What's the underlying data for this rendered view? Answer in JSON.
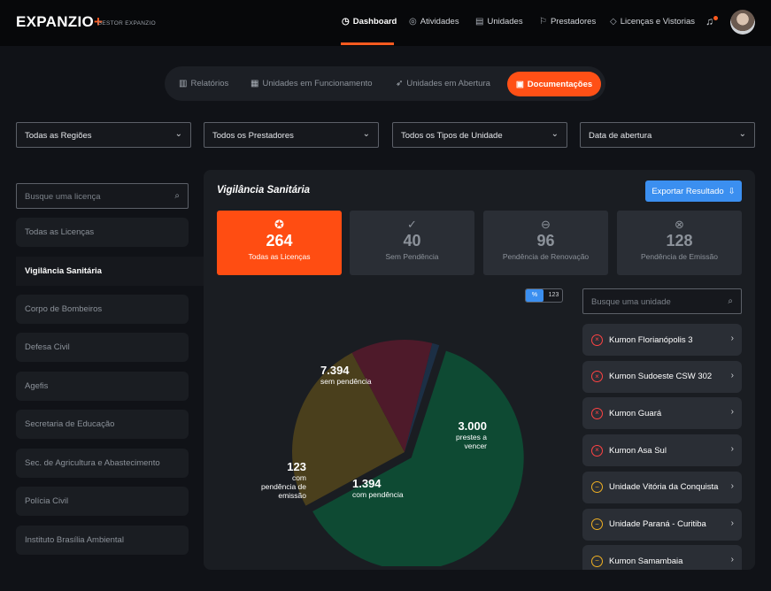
{
  "header": {
    "logo": "EXPANZIO",
    "logo_plus": "+",
    "logo_sub": "GESTOR EXPANZIO",
    "nav": [
      {
        "label": "Dashboard",
        "icon": "gauge-icon"
      },
      {
        "label": "Atividades",
        "icon": "check-circle-icon"
      },
      {
        "label": "Unidades",
        "icon": "building-icon"
      },
      {
        "label": "Prestadores",
        "icon": "flag-icon"
      },
      {
        "label": "Licenças e Vistorias",
        "icon": "tag-icon"
      }
    ]
  },
  "segments": {
    "items": [
      "Relatórios",
      "Unidades em Funcionamento",
      "Unidades em Abertura"
    ],
    "active": "Documentações"
  },
  "filters": [
    "Todas as Regiões",
    "Todos os Prestadores",
    "Todos os Tipos de Unidade",
    "Data de abertura"
  ],
  "sidebar": {
    "search_placeholder": "Busque uma licença",
    "items": [
      "Todas as Licenças",
      "Vigilância Sanitária",
      "Corpo de Bombeiros",
      "Defesa Civil",
      "Agefis",
      "Secretaria de Educação",
      "Sec. de Agricultura e Abastecimento",
      "Polícia Civil",
      "Instituto Brasília Ambiental"
    ],
    "active_index": 1
  },
  "panel": {
    "title": "Vigilância Sanitária",
    "export_label": "Exportar Resultado"
  },
  "cards": [
    {
      "value": "264",
      "label": "Todas as Licenças",
      "icon": "award-icon"
    },
    {
      "value": "40",
      "label": "Sem Pendência",
      "icon": "check-circle-icon"
    },
    {
      "value": "96",
      "label": "Pendência de Renovação",
      "icon": "minus-circle-icon"
    },
    {
      "value": "128",
      "label": "Pendência de Emissão",
      "icon": "x-circle-icon"
    }
  ],
  "toggle": {
    "percent": "%",
    "number": "123"
  },
  "chart_data": {
    "type": "pie",
    "slices": [
      {
        "value": 7394,
        "display": "7.394",
        "label": "sem pendência",
        "color": "#0e4a33"
      },
      {
        "value": 3000,
        "display": "3.000",
        "label": "prestes a vencer",
        "color": "#4a3f1c"
      },
      {
        "value": 1394,
        "display": "1.394",
        "label": "com pendência",
        "color": "#4e1a2a"
      },
      {
        "value": 123,
        "display": "123",
        "label": "com pendência de emissão",
        "color": "#1c2f45"
      }
    ]
  },
  "unit_search_placeholder": "Busque uma unidade",
  "units": [
    {
      "name": "Kumon Florianópolis 3",
      "status": "error"
    },
    {
      "name": "Kumon Sudoeste CSW 302",
      "status": "error"
    },
    {
      "name": "Kumon Guará",
      "status": "error"
    },
    {
      "name": "Kumon Asa Sul",
      "status": "error"
    },
    {
      "name": "Unidade Vitória da Conquista",
      "status": "warning"
    },
    {
      "name": "Unidade Paraná - Curitiba",
      "status": "warning"
    },
    {
      "name": "Kumon Samambaia",
      "status": "warning"
    }
  ],
  "colors": {
    "accent": "#ff5016",
    "blue": "#3b8ff0",
    "error": "#ff4343",
    "warning": "#f0b023"
  }
}
